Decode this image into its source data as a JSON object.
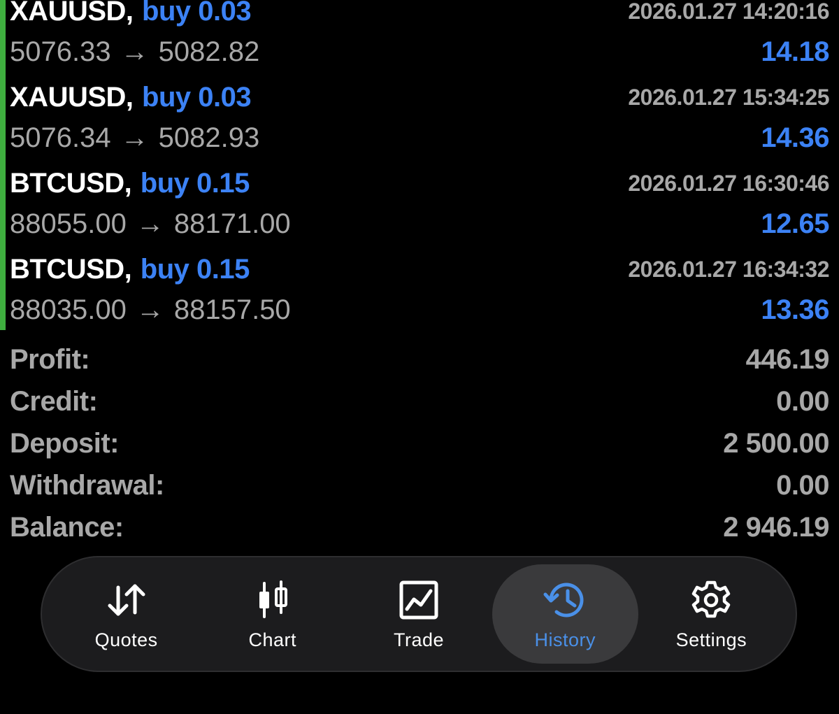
{
  "trades": [
    {
      "symbol": "XAUUSD",
      "side": "buy 0.03",
      "time": "2026.01.27 14:20:16",
      "open": "5076.33",
      "close": "5082.82",
      "profit": "14.18"
    },
    {
      "symbol": "XAUUSD",
      "side": "buy 0.03",
      "time": "2026.01.27 15:34:25",
      "open": "5076.34",
      "close": "5082.93",
      "profit": "14.36"
    },
    {
      "symbol": "BTCUSD",
      "side": "buy 0.15",
      "time": "2026.01.27 16:30:46",
      "open": "88055.00",
      "close": "88171.00",
      "profit": "12.65"
    },
    {
      "symbol": "BTCUSD",
      "side": "buy 0.15",
      "time": "2026.01.27 16:34:32",
      "open": "88035.00",
      "close": "88157.50",
      "profit": "13.36"
    }
  ],
  "summary": [
    {
      "label": "Profit:",
      "value": "446.19"
    },
    {
      "label": "Credit:",
      "value": "0.00"
    },
    {
      "label": "Deposit:",
      "value": "2 500.00"
    },
    {
      "label": "Withdrawal:",
      "value": "0.00"
    },
    {
      "label": "Balance:",
      "value": "2 946.19"
    }
  ],
  "tabs": [
    {
      "label": "Quotes",
      "icon": "quotes-arrows-icon"
    },
    {
      "label": "Chart",
      "icon": "candlestick-chart-icon"
    },
    {
      "label": "Trade",
      "icon": "trade-chart-icon"
    },
    {
      "label": "History",
      "icon": "history-clock-icon",
      "active": true
    },
    {
      "label": "Settings",
      "icon": "gear-icon"
    }
  ],
  "colors": {
    "accent_blue": "#3c82f5",
    "active_tab_blue": "#4a90e8",
    "trade_accent_green": "#3fae3f",
    "muted_text": "#a8a8a8",
    "background": "#000000"
  }
}
